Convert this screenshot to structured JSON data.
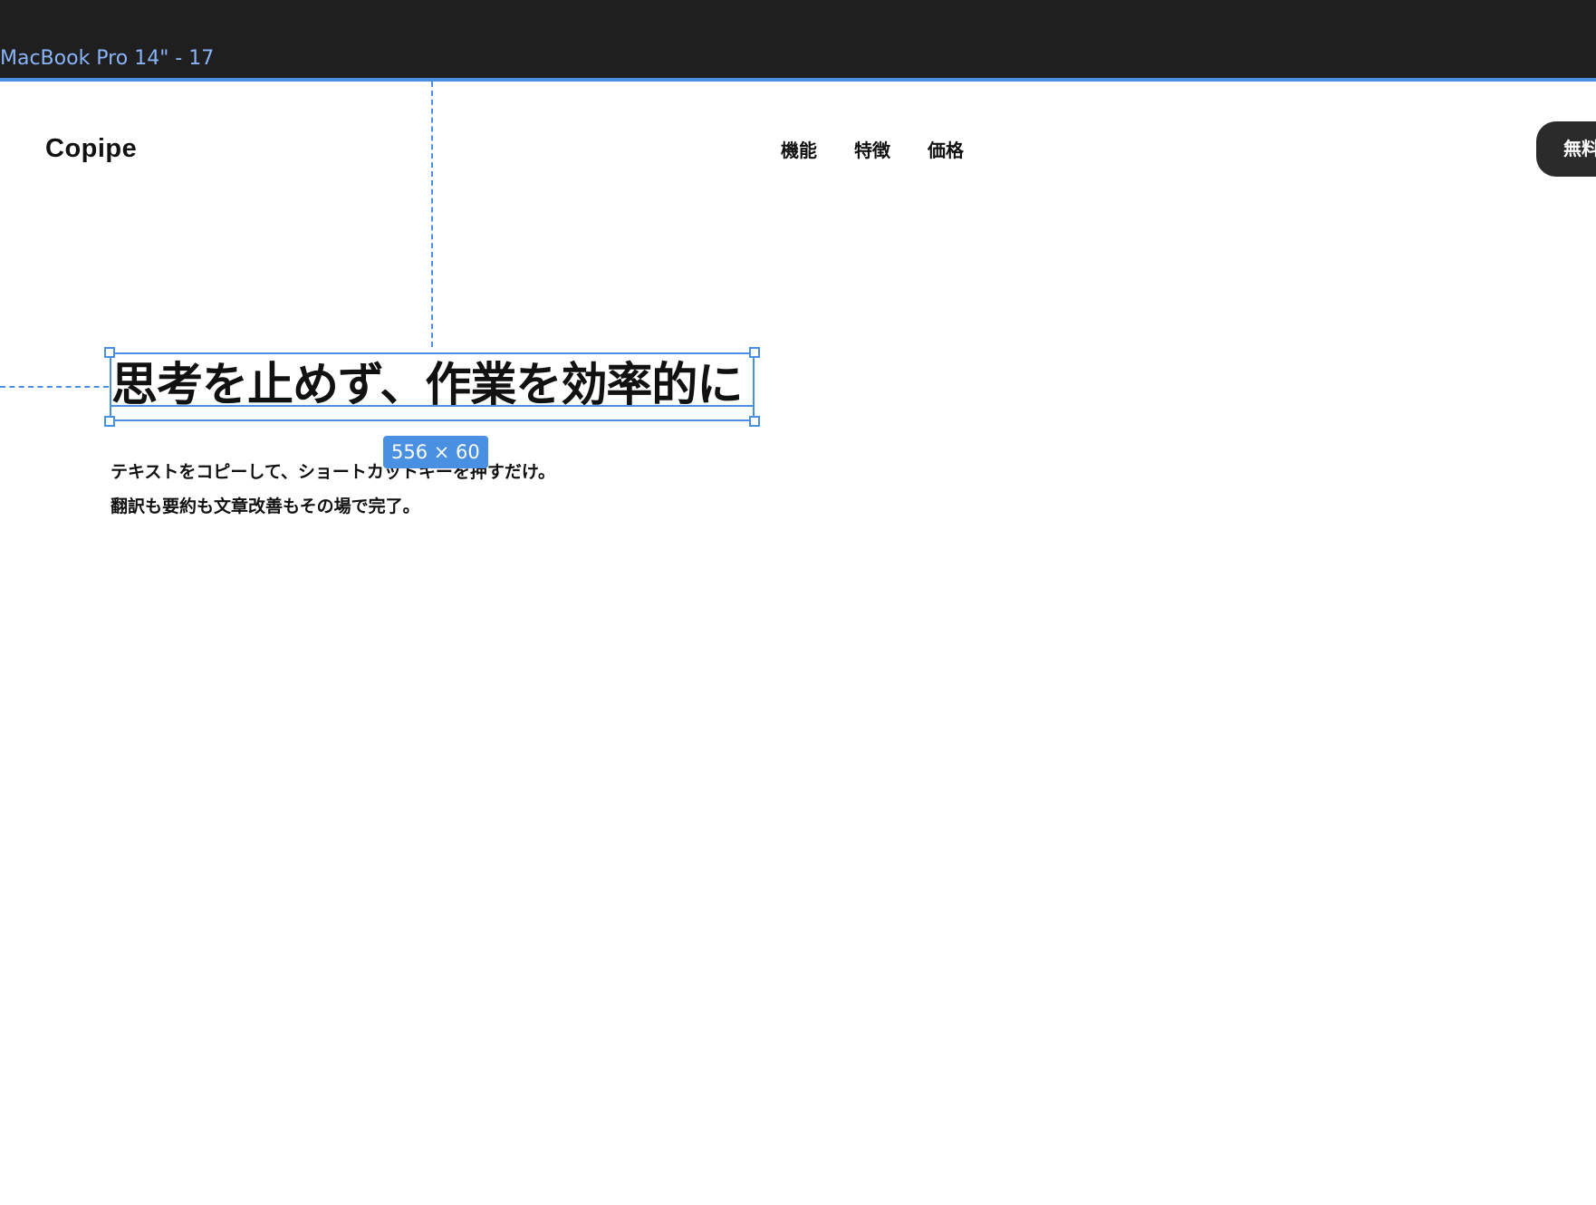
{
  "editor": {
    "frame_label": "MacBook Pro 14\" - 17",
    "size_badge": "556 × 60"
  },
  "header": {
    "logo": "Copipe",
    "nav": [
      "機能",
      "特徴",
      "価格"
    ],
    "cta_label": "無料"
  },
  "hero": {
    "headline": "思考を止めず、作業を効率的に",
    "subtext_line1": "テキストをコピーして、ショートカットキーを押すだけ。",
    "subtext_line2": "翻訳も要約も文章改善もその場で完了。"
  },
  "colors": {
    "accent": "#4a90e2",
    "topbar": "#1f1f1f",
    "cta_bg": "#2b2b2b"
  }
}
